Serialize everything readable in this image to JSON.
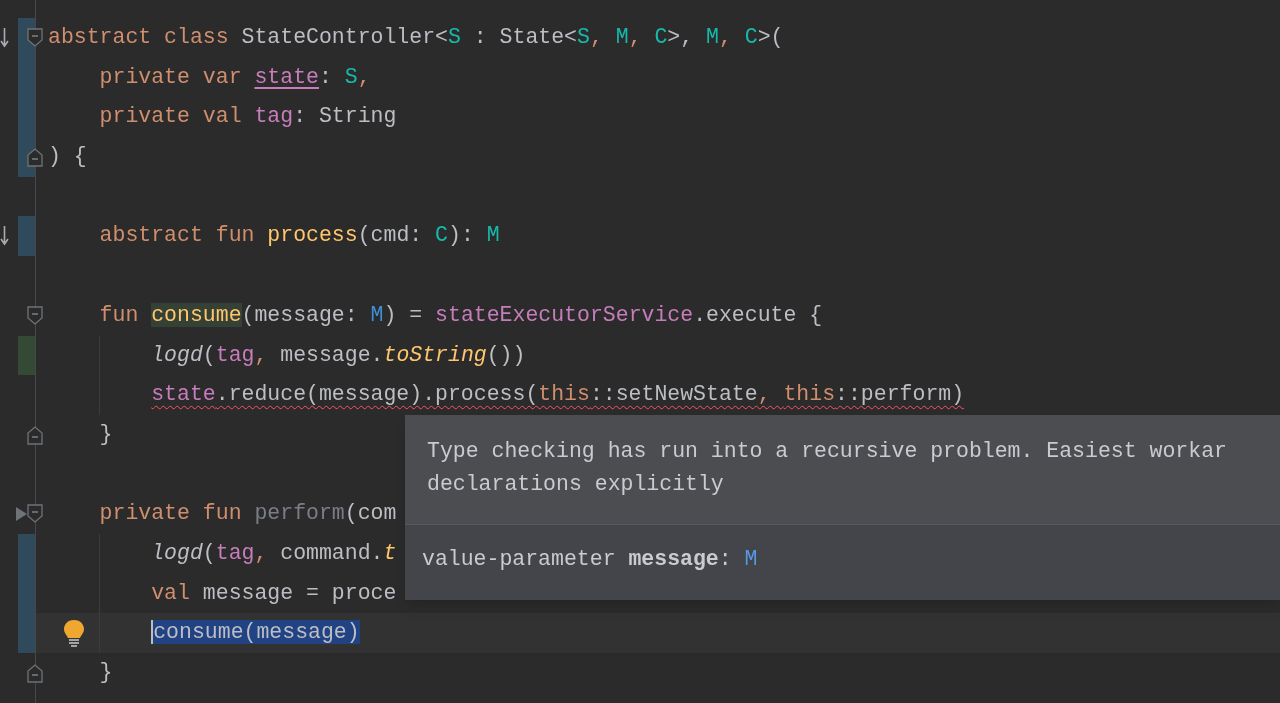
{
  "editor": {
    "lines": [
      {
        "kind": "code",
        "implemented": true,
        "modified": true,
        "fold_start": true,
        "tokens": [
          {
            "text": "abstract class ",
            "kind": "keyword"
          },
          {
            "text": "StateController<",
            "kind": "plain"
          },
          {
            "text": "S",
            "kind": "type_param"
          },
          {
            "text": " : State<",
            "kind": "plain"
          },
          {
            "text": "S",
            "kind": "type_param"
          },
          {
            "text": ", ",
            "kind": "comma"
          },
          {
            "text": "M",
            "kind": "type_param"
          },
          {
            "text": ", ",
            "kind": "comma"
          },
          {
            "text": "C",
            "kind": "type_param"
          },
          {
            "text": ">, ",
            "kind": "plain"
          },
          {
            "text": "M",
            "kind": "type_param"
          },
          {
            "text": ", ",
            "kind": "comma"
          },
          {
            "text": "C",
            "kind": "type_param"
          },
          {
            "text": ">(",
            "kind": "plain"
          }
        ],
        "children": [
          {
            "kind": "code",
            "modified": true,
            "tokens": [
              {
                "text": "private var ",
                "kind": "keyword"
              },
              {
                "text": "state",
                "kind": "mutable"
              },
              {
                "text": ": ",
                "kind": "plain"
              },
              {
                "text": "S",
                "kind": "type_param"
              },
              {
                "text": ",",
                "kind": "comma"
              }
            ]
          },
          {
            "kind": "code",
            "modified": true,
            "tokens": [
              {
                "text": "private val ",
                "kind": "keyword"
              },
              {
                "text": "tag",
                "kind": "property"
              },
              {
                "text": ": String",
                "kind": "plain"
              }
            ]
          }
        ]
      },
      {
        "kind": "code",
        "modified": true,
        "fold_end": true,
        "tokens": [
          {
            "text": ") {",
            "kind": "plain"
          }
        ],
        "children": [
          {
            "kind": "blank"
          },
          {
            "kind": "code",
            "implemented": true,
            "modified": true,
            "tokens": [
              {
                "text": "abstract fun ",
                "kind": "keyword"
              },
              {
                "text": "process",
                "kind": "declaration"
              },
              {
                "text": "(cmd: ",
                "kind": "plain"
              },
              {
                "text": "C",
                "kind": "type_param"
              },
              {
                "text": "): ",
                "kind": "plain"
              },
              {
                "text": "M",
                "kind": "type_param"
              }
            ]
          },
          {
            "kind": "blank"
          },
          {
            "kind": "code",
            "fold_start": true,
            "tokens": [
              {
                "text": "fun ",
                "kind": "keyword"
              },
              {
                "text": "consume",
                "kind": "declaration",
                "highlight": true
              },
              {
                "text": "(message: ",
                "kind": "plain"
              },
              {
                "text": "M",
                "kind": "type_ref"
              },
              {
                "text": ") = ",
                "kind": "plain"
              },
              {
                "text": "stateExecutorService",
                "kind": "property"
              },
              {
                "text": ".execute {",
                "kind": "plain"
              }
            ],
            "children": [
              {
                "kind": "code",
                "added": true,
                "tokens": [
                  {
                    "text": "logd",
                    "kind": "call"
                  },
                  {
                    "text": "(",
                    "kind": "plain"
                  },
                  {
                    "text": "tag",
                    "kind": "property"
                  },
                  {
                    "text": ", ",
                    "kind": "comma"
                  },
                  {
                    "text": "message.",
                    "kind": "plain"
                  },
                  {
                    "text": "toString",
                    "kind": "ext_call"
                  },
                  {
                    "text": "())",
                    "kind": "plain"
                  }
                ]
              },
              {
                "kind": "code",
                "tokens": [
                  {
                    "text": "state",
                    "kind": "property",
                    "error": true
                  },
                  {
                    "text": ".reduce(message).process(",
                    "kind": "plain",
                    "error": true
                  },
                  {
                    "text": "this",
                    "kind": "keyword",
                    "error": true
                  },
                  {
                    "text": "::setNewState",
                    "kind": "plain",
                    "error": true
                  },
                  {
                    "text": ", ",
                    "kind": "comma",
                    "error": true
                  },
                  {
                    "text": "this",
                    "kind": "keyword",
                    "error": true
                  },
                  {
                    "text": "::perform)",
                    "kind": "plain",
                    "error": true
                  }
                ]
              }
            ]
          },
          {
            "kind": "code",
            "fold_end": true,
            "tokens": [
              {
                "text": "}",
                "kind": "plain"
              }
            ]
          },
          {
            "kind": "blank"
          },
          {
            "kind": "code",
            "runnable": true,
            "fold_start": true,
            "tokens": [
              {
                "text": "private fun ",
                "kind": "keyword"
              },
              {
                "text": "perform",
                "kind": "unused"
              },
              {
                "text": "(com",
                "kind": "plain"
              }
            ],
            "children": [
              {
                "kind": "code",
                "modified": true,
                "tokens": [
                  {
                    "text": "logd",
                    "kind": "call"
                  },
                  {
                    "text": "(",
                    "kind": "plain"
                  },
                  {
                    "text": "tag",
                    "kind": "property"
                  },
                  {
                    "text": ", ",
                    "kind": "comma"
                  },
                  {
                    "text": "command.",
                    "kind": "plain"
                  },
                  {
                    "text": "t",
                    "kind": "ext_call"
                  }
                ]
              },
              {
                "kind": "code",
                "modified": true,
                "tokens": [
                  {
                    "text": "val ",
                    "kind": "keyword"
                  },
                  {
                    "text": "message = proce",
                    "kind": "plain"
                  }
                ]
              },
              {
                "kind": "code",
                "intention": true,
                "modified": true,
                "current": true,
                "tokens": [
                  {
                    "text": "consume(message)",
                    "kind": "plain",
                    "selected": true
                  }
                ]
              }
            ]
          },
          {
            "kind": "code",
            "fold_end": true,
            "tokens": [
              {
                "text": "}",
                "kind": "plain"
              }
            ]
          }
        ]
      }
    ]
  },
  "tooltip": {
    "message": "Type checking has run into a recursive problem. Easiest workar\ndeclarations explicitly",
    "signature": [
      {
        "text": "value-parameter ",
        "kind": "plain"
      },
      {
        "text": "message",
        "kind": "bold"
      },
      {
        "text": ": ",
        "kind": "plain"
      },
      {
        "text": "M",
        "kind": "type"
      }
    ]
  }
}
